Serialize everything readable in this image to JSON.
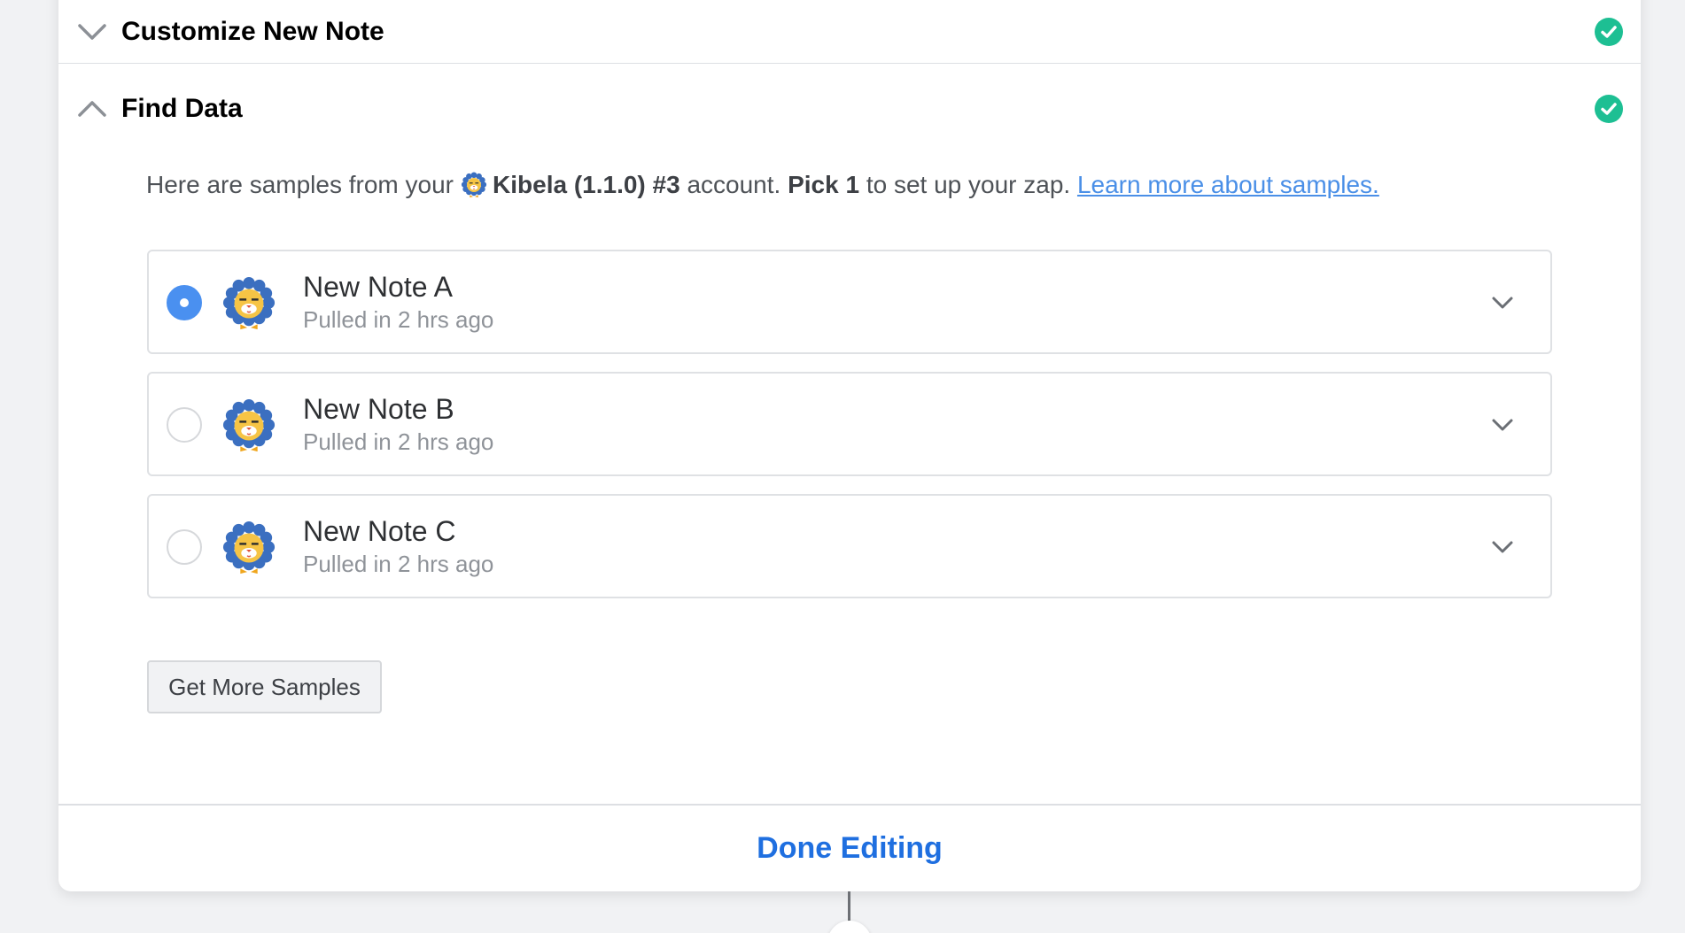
{
  "sections": {
    "customize": {
      "title": "Customize New Note",
      "status_icon": "check-circle-icon",
      "expanded": false
    },
    "find_data": {
      "title": "Find Data",
      "status_icon": "check-circle-icon",
      "expanded": true
    }
  },
  "intro": {
    "prefix": "Here are samples from your",
    "account": "Kibela (1.1.0) #3",
    "middle": "account.",
    "pick": "Pick 1",
    "suffix": "to set up your zap.",
    "link": "Learn more about samples."
  },
  "samples": [
    {
      "name": "New Note A",
      "sub": "Pulled in 2 hrs ago",
      "selected": true
    },
    {
      "name": "New Note B",
      "sub": "Pulled in 2 hrs ago",
      "selected": false
    },
    {
      "name": "New Note C",
      "sub": "Pulled in 2 hrs ago",
      "selected": false
    }
  ],
  "buttons": {
    "more": "Get More Samples",
    "done": "Done Editing"
  },
  "colors": {
    "accent": "#1f6fe0",
    "success": "#1dbf93",
    "radio": "#4a90f0",
    "link": "#4a8fe7"
  }
}
